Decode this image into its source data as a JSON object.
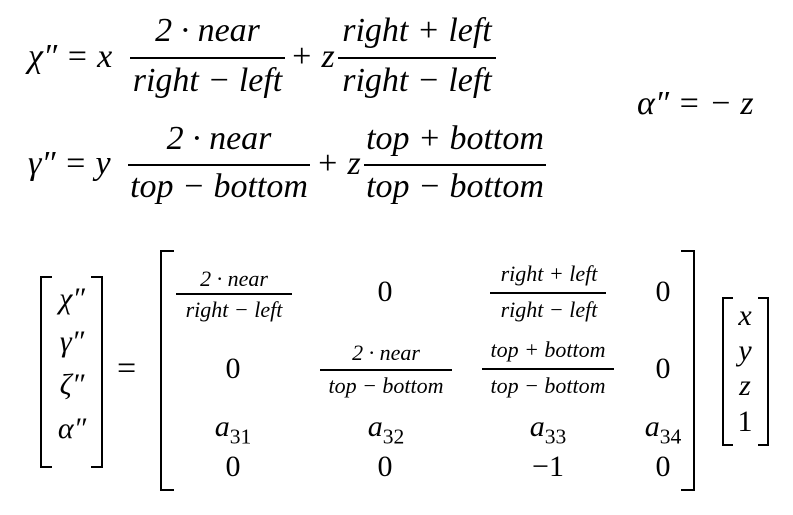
{
  "eq1": {
    "lhs": "χ″ = x",
    "frac1_num": "2 · near",
    "frac1_den": "right − left",
    "plus_z": "+ z",
    "frac2_num": "right + left",
    "frac2_den": "right − left"
  },
  "eq2": {
    "lhs": "γ″ = y",
    "frac1_num": "2 · near",
    "frac1_den": "top − bottom",
    "plus_z": "+ z",
    "frac2_num": "top + bottom",
    "frac2_den": "top − bottom"
  },
  "alpha_eq": "α″ = − z",
  "lhs_vector": [
    "χ″",
    "γ″",
    "ζ″",
    "α″"
  ],
  "equals": "=",
  "matrix": {
    "r1c1_num": "2 · near",
    "r1c1_den": "right − left",
    "r1c2": "0",
    "r1c3_num": "right + left",
    "r1c3_den": "right − left",
    "r1c4": "0",
    "r2c1": "0",
    "r2c2_num": "2 · near",
    "r2c2_den": "top − bottom",
    "r2c3_num": "top + bottom",
    "r2c3_den": "top − bottom",
    "r2c4": "0",
    "r3c1": "a",
    "r3c1_sub": "31",
    "r3c2": "a",
    "r3c2_sub": "32",
    "r3c3": "a",
    "r3c3_sub": "33",
    "r3c4": "a",
    "r3c4_sub": "34",
    "r4c1": "0",
    "r4c2": "0",
    "r4c3": "−1",
    "r4c4": "0"
  },
  "rhs_vector": [
    "x",
    "y",
    "z",
    "1"
  ]
}
